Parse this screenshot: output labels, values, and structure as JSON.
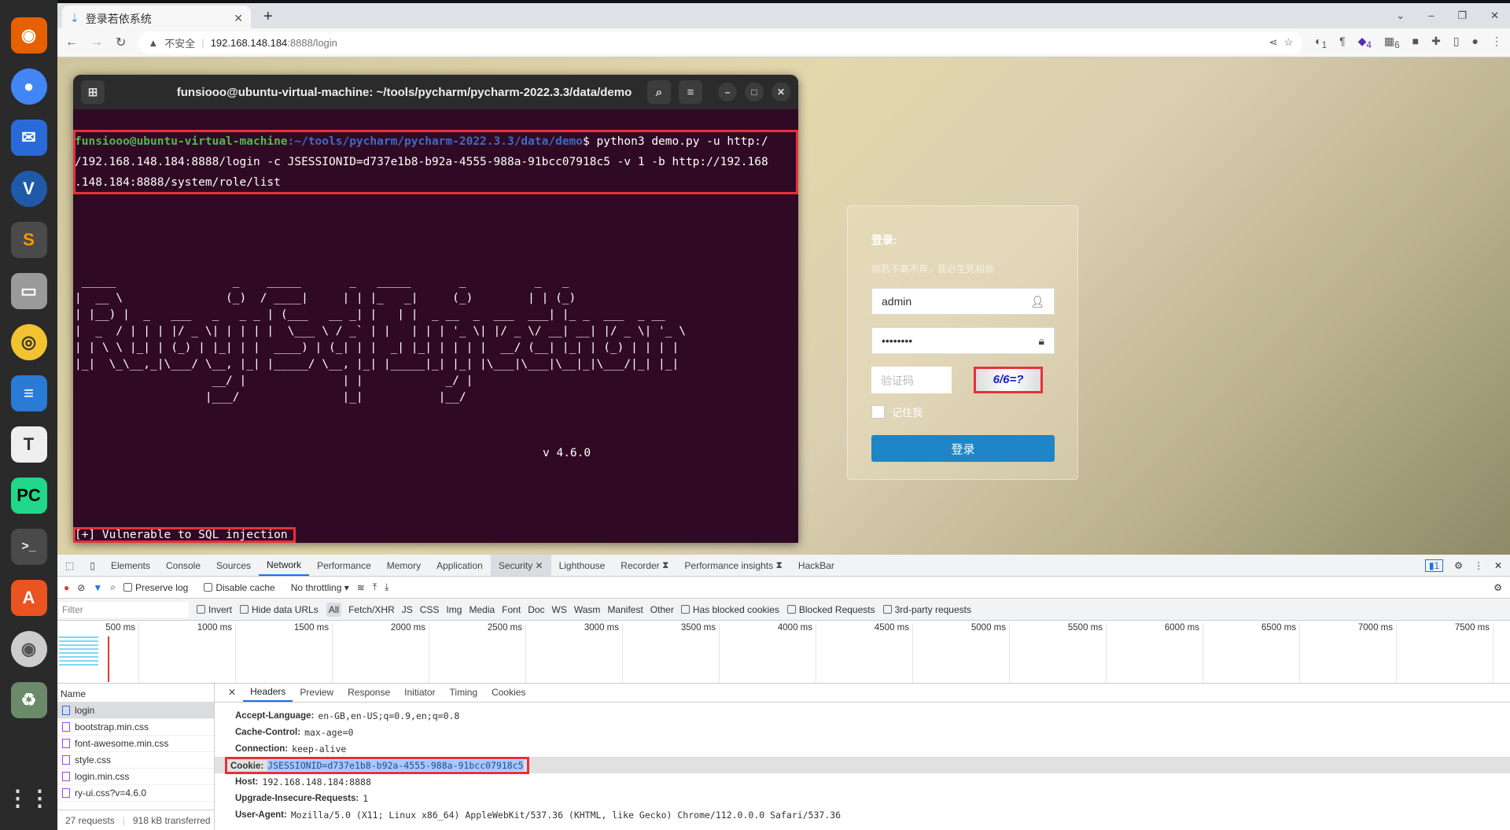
{
  "dock": {
    "apps": [
      "Firefox",
      "Chrome",
      "Thunderbird",
      "Vim",
      "Sublime Text",
      "Files",
      "Rhythmbox",
      "LibreOffice Writer",
      "Text Editor",
      "PyCharm",
      "Terminal",
      "App Center",
      "Disc",
      "Trash",
      "Show Apps"
    ]
  },
  "browser": {
    "tab_title": "登录若依系统",
    "url_warning": "不安全",
    "url_host": "192.168.148.184",
    "url_path": ":8888/login",
    "ext_badges": [
      "1",
      "4",
      "6"
    ]
  },
  "terminal": {
    "title": "funsiooo@ubuntu-virtual-machine: ~/tools/pycharm/pycharm-2022.3.3/data/demo",
    "prompt_user": "funsiooo@ubuntu-virtual-machine",
    "prompt_path": ":~/tools/pycharm/pycharm-2022.3.3/data/demo",
    "prompt_dollar": "$",
    "command_lines": [
      " python3 demo.py -u http:/",
      "/192.168.148.184:8888/login -c JSESSIONID=d737e1b8-b92a-4555-988a-91bcc07918c5 -v 1 -b http://192.168",
      ".148.184:8888/system/role/list"
    ],
    "banner": [
      " _____                 _    _____       _   _____       _          _   _",
      "|  __ \\               (_)  / ____|     | | |_   _|     (_)        | | (_)",
      "| |__) |  _   ___   _   _ _ | (___   __ _| |   | |  _ __  _  ___  ___| |_ _  ___  _ __",
      "|  _  / | | | |/ _ \\| | | | |  \\___ \\ / _` | |   | | | '_ \\| |/ _ \\/ __| __| |/ _ \\| '_ \\",
      "| | \\ \\ |_| | (_) | |_| | |  ____) | (_| | |  _| |_| | | | |  __/ (__| |_| | (_) | | | |",
      "|_|  \\_\\__,_|\\___/ \\__, |_| |_____/ \\__, |_| |_____|_| |_| |\\___|\\___|\\__|_|\\___/|_| |_|",
      "                    __/ |              | |            _/ |",
      "                   |___/               |_|           |__/"
    ],
    "version": "v 4.6.0",
    "result": "[+] Vulnerable to SQL injection"
  },
  "login": {
    "heading": "登录:",
    "subtitle": "你若不离不弃，我必生死相依",
    "username": "admin",
    "password": "••••••••",
    "captcha_placeholder": "验证码",
    "captcha_text": "6/6=?",
    "remember": "记住我",
    "submit": "登录"
  },
  "devtools": {
    "tabs": [
      "Elements",
      "Console",
      "Sources",
      "Network",
      "Performance",
      "Memory",
      "Application",
      "Security",
      "Lighthouse",
      "Recorder",
      "Performance insights",
      "HackBar"
    ],
    "active_tab": "Network",
    "issues_count": "1",
    "preserve_log": "Preserve log",
    "disable_cache": "Disable cache",
    "throttling": "No throttling",
    "filter_placeholder": "Filter",
    "invert": "Invert",
    "hide_data_urls": "Hide data URLs",
    "types": [
      "All",
      "Fetch/XHR",
      "JS",
      "CSS",
      "Img",
      "Media",
      "Font",
      "Doc",
      "WS",
      "Wasm",
      "Manifest",
      "Other"
    ],
    "has_blocked_cookies": "Has blocked cookies",
    "blocked_requests": "Blocked Requests",
    "third_party": "3rd-party requests",
    "timeline_ticks": [
      "500 ms",
      "1000 ms",
      "1500 ms",
      "2000 ms",
      "2500 ms",
      "3000 ms",
      "3500 ms",
      "4000 ms",
      "4500 ms",
      "5000 ms",
      "5500 ms",
      "6000 ms",
      "6500 ms",
      "7000 ms",
      "7500 ms"
    ],
    "name_header": "Name",
    "requests": [
      "login",
      "bootstrap.min.css",
      "font-awesome.min.css",
      "style.css",
      "login.min.css",
      "ry-ui.css?v=4.6.0"
    ],
    "footer_requests": "27 requests",
    "footer_transferred": "918 kB transferred",
    "detail_tabs": [
      "Headers",
      "Preview",
      "Response",
      "Initiator",
      "Timing",
      "Cookies"
    ],
    "headers": [
      {
        "k": "Accept-Language:",
        "v": "en-GB,en-US;q=0.9,en;q=0.8"
      },
      {
        "k": "Cache-Control:",
        "v": "max-age=0"
      },
      {
        "k": "Connection:",
        "v": "keep-alive"
      },
      {
        "k": "Cookie:",
        "v": "JSESSIONID=d737e1b8-b92a-4555-988a-91bcc07918c5"
      },
      {
        "k": "Host:",
        "v": "192.168.148.184:8888"
      },
      {
        "k": "Upgrade-Insecure-Requests:",
        "v": "1"
      },
      {
        "k": "User-Agent:",
        "v": "Mozilla/5.0 (X11; Linux x86_64) AppleWebKit/537.36 (KHTML, like Gecko) Chrome/112.0.0.0 Safari/537.36"
      }
    ]
  }
}
